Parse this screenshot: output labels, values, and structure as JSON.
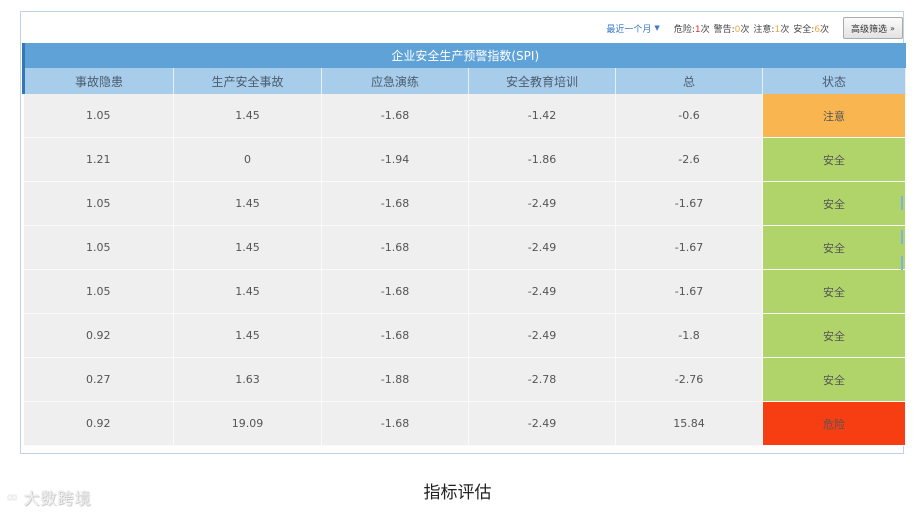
{
  "toolbar": {
    "range_label": "最近一个月",
    "stats": [
      {
        "label": "危险:",
        "count": "1",
        "unit": "次",
        "kind": "danger"
      },
      {
        "label": "警告:",
        "count": "0",
        "unit": "次",
        "kind": "warning"
      },
      {
        "label": "注意:",
        "count": "1",
        "unit": "次",
        "kind": "attention"
      },
      {
        "label": "安全:",
        "count": "6",
        "unit": "次",
        "kind": "safe"
      }
    ],
    "filter_label": "高级筛选"
  },
  "table": {
    "title": "企业安全生产预警指数(SPI)",
    "columns": [
      "事故隐患",
      "生产安全事故",
      "应急演练",
      "安全教育培训",
      "总",
      "状态"
    ],
    "rows": [
      {
        "cells": [
          "1.05",
          "1.45",
          "-1.68",
          "-1.42",
          "-0.6"
        ],
        "status": "注意",
        "status_kind": "attention"
      },
      {
        "cells": [
          "1.21",
          "0",
          "-1.94",
          "-1.86",
          "-2.6"
        ],
        "status": "安全",
        "status_kind": "safe"
      },
      {
        "cells": [
          "1.05",
          "1.45",
          "-1.68",
          "-2.49",
          "-1.67"
        ],
        "status": "安全",
        "status_kind": "safe"
      },
      {
        "cells": [
          "1.05",
          "1.45",
          "-1.68",
          "-2.49",
          "-1.67"
        ],
        "status": "安全",
        "status_kind": "safe"
      },
      {
        "cells": [
          "1.05",
          "1.45",
          "-1.68",
          "-2.49",
          "-1.67"
        ],
        "status": "安全",
        "status_kind": "safe"
      },
      {
        "cells": [
          "0.92",
          "1.45",
          "-1.68",
          "-2.49",
          "-1.8"
        ],
        "status": "安全",
        "status_kind": "safe"
      },
      {
        "cells": [
          "0.27",
          "1.63",
          "-1.88",
          "-2.78",
          "-2.76"
        ],
        "status": "安全",
        "status_kind": "safe"
      },
      {
        "cells": [
          "0.92",
          "19.09",
          "-1.68",
          "-2.49",
          "15.84"
        ],
        "status": "危险",
        "status_kind": "danger"
      }
    ]
  },
  "caption": "指标评估",
  "watermark": {
    "icon": "infinity-logo-icon",
    "text": "大数跨境"
  },
  "colors": {
    "header": "#5ea2d8",
    "subheader": "#a8cdeb",
    "attention": "#f9b550",
    "safe": "#b1d46a",
    "danger": "#f63e12"
  }
}
